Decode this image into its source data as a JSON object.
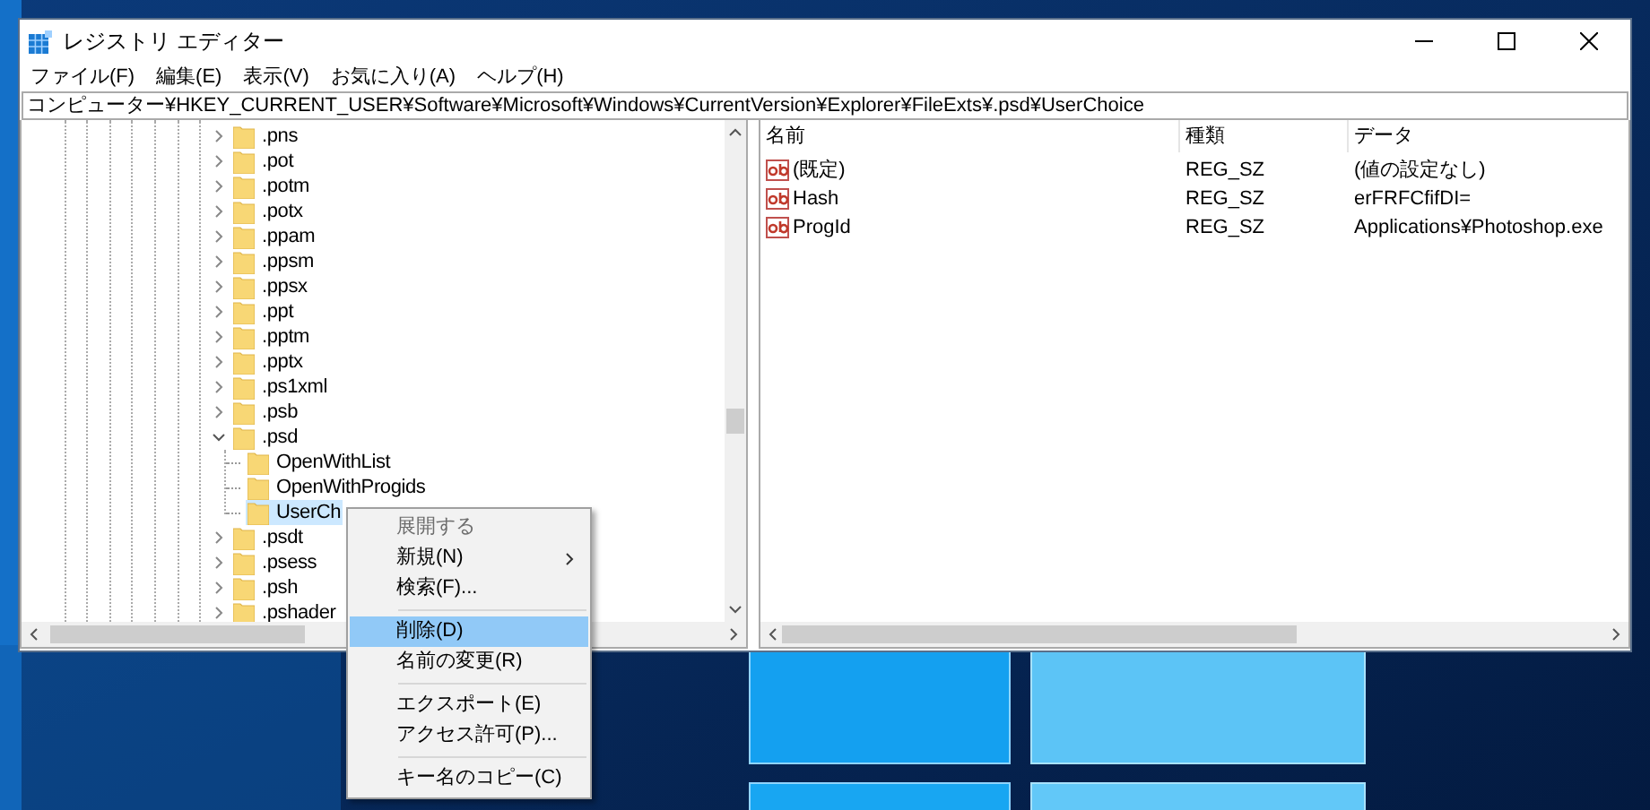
{
  "window": {
    "title": "レジストリ エディター"
  },
  "menu_bar": [
    "ファイル(F)",
    "編集(E)",
    "表示(V)",
    "お気に入り(A)",
    "ヘルプ(H)"
  ],
  "address": "コンピューター¥HKEY_CURRENT_USER¥Software¥Microsoft¥Windows¥CurrentVersion¥Explorer¥FileExts¥.psd¥UserChoice",
  "tree": {
    "items": [
      {
        "label": ".pns",
        "expanded": false,
        "selected": false
      },
      {
        "label": ".pot",
        "expanded": false,
        "selected": false
      },
      {
        "label": ".potm",
        "expanded": false,
        "selected": false
      },
      {
        "label": ".potx",
        "expanded": false,
        "selected": false
      },
      {
        "label": ".ppam",
        "expanded": false,
        "selected": false
      },
      {
        "label": ".ppsm",
        "expanded": false,
        "selected": false
      },
      {
        "label": ".ppsx",
        "expanded": false,
        "selected": false
      },
      {
        "label": ".ppt",
        "expanded": false,
        "selected": false
      },
      {
        "label": ".pptm",
        "expanded": false,
        "selected": false
      },
      {
        "label": ".pptx",
        "expanded": false,
        "selected": false
      },
      {
        "label": ".ps1xml",
        "expanded": false,
        "selected": false
      },
      {
        "label": ".psb",
        "expanded": false,
        "selected": false
      },
      {
        "label": ".psd",
        "expanded": true,
        "selected": false,
        "children": [
          {
            "label": "OpenWithList",
            "selected": false
          },
          {
            "label": "OpenWithProgids",
            "selected": false
          },
          {
            "label": "UserCh",
            "selected": true
          }
        ]
      },
      {
        "label": ".psdt",
        "expanded": false,
        "selected": false
      },
      {
        "label": ".psess",
        "expanded": false,
        "selected": false
      },
      {
        "label": ".psh",
        "expanded": false,
        "selected": false
      },
      {
        "label": ".pshader",
        "expanded": false,
        "selected": false
      }
    ]
  },
  "values": {
    "columns": [
      "名前",
      "種類",
      "データ"
    ],
    "rows": [
      {
        "name": "(既定)",
        "type": "REG_SZ",
        "data": "(値の設定なし)"
      },
      {
        "name": "Hash",
        "type": "REG_SZ",
        "data": "erFRFCfifDI="
      },
      {
        "name": "ProgId",
        "type": "REG_SZ",
        "data": "Applications¥Photoshop.exe"
      }
    ]
  },
  "context_menu": {
    "items": [
      {
        "kind": "item",
        "label": "展開する",
        "disabled": true,
        "selected": false,
        "submenu": false
      },
      {
        "kind": "item",
        "label": "新規(N)",
        "disabled": false,
        "selected": false,
        "submenu": true
      },
      {
        "kind": "item",
        "label": "検索(F)...",
        "disabled": false,
        "selected": false,
        "submenu": false
      },
      {
        "kind": "separator"
      },
      {
        "kind": "item",
        "label": "削除(D)",
        "disabled": false,
        "selected": true,
        "submenu": false
      },
      {
        "kind": "item",
        "label": "名前の変更(R)",
        "disabled": false,
        "selected": false,
        "submenu": false
      },
      {
        "kind": "separator"
      },
      {
        "kind": "item",
        "label": "エクスポート(E)",
        "disabled": false,
        "selected": false,
        "submenu": false
      },
      {
        "kind": "item",
        "label": "アクセス許可(P)...",
        "disabled": false,
        "selected": false,
        "submenu": false
      },
      {
        "kind": "separator"
      },
      {
        "kind": "item",
        "label": "キー名のコピー(C)",
        "disabled": false,
        "selected": false,
        "submenu": false
      }
    ]
  }
}
